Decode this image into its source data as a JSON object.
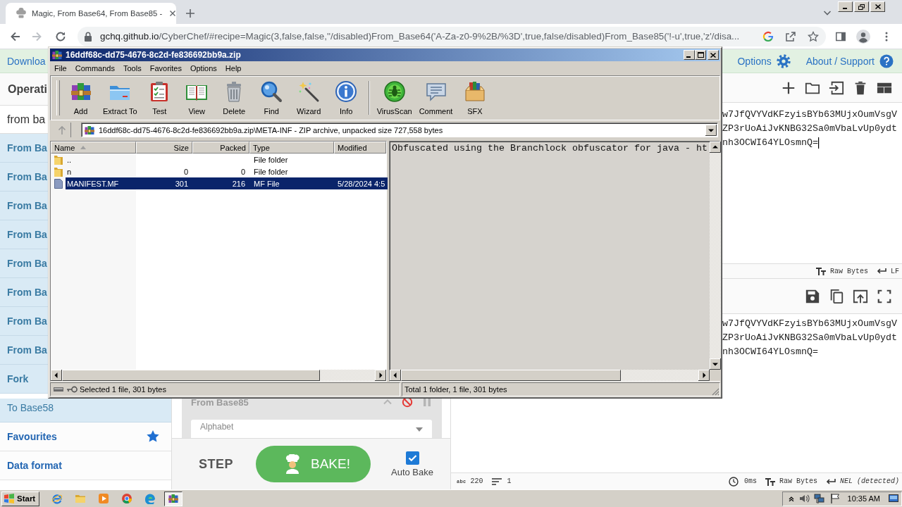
{
  "browser": {
    "tab": {
      "title": "Magic, From Base64, From Base85 -"
    },
    "address": {
      "host": "gchq.github.io",
      "path": "/CyberChef/#recipe=Magic(3,false,false,''/disabled)From_Base64('A-Za-z0-9%2B/%3D',true,false/disabled)From_Base85('!-u',true,'z'/disa..."
    }
  },
  "banner": {
    "download": "Downloa",
    "links": [
      {
        "label": "Options",
        "kind": "options"
      },
      {
        "label": "About / Support",
        "kind": "support"
      }
    ]
  },
  "operations": {
    "heading": "Operati",
    "search": {
      "value": "from ba"
    },
    "items": [
      {
        "label": "From Ba",
        "matched": true
      },
      {
        "label": "From Ba",
        "matched": true
      },
      {
        "label": "From Ba",
        "matched": true
      },
      {
        "label": "From Ba",
        "matched": true
      },
      {
        "label": "From Ba",
        "matched": true
      },
      {
        "label": "From Ba",
        "matched": true
      },
      {
        "label": "From Ba",
        "matched": true
      },
      {
        "label": "From Ba",
        "matched": true
      },
      {
        "label": "Fork",
        "matched": true
      },
      {
        "label": "To Base58",
        "matched": false
      }
    ],
    "categories": [
      {
        "label": "Favourites",
        "kind": "favourites"
      },
      {
        "label": "Data format",
        "kind": "category"
      }
    ]
  },
  "recipe": {
    "operation": {
      "title": "From Base85",
      "disabled": true,
      "field": {
        "label": "Alphabet"
      }
    },
    "step": "STEP",
    "bake": "BAKE!",
    "auto_bake": {
      "label": "Auto Bake",
      "checked": true
    }
  },
  "input": {
    "lines": [
      "w7JfQVYVdKFzyisBYb63MUjxOumVsgV",
      "ZP3rUoAiJvKNBG32Sa0mVbaLvUp0ydt",
      "nh3OCWI64YLOsmnQ="
    ],
    "caret": true,
    "status": {
      "format": "Raw Bytes",
      "eol": "LF"
    }
  },
  "output": {
    "lines": [
      "w7JfQVYVdKFzyisBYb63MUjxOumVsgV",
      "ZP3rUoAiJvKNBG32Sa0mVbaLvUp0ydt",
      "nh3OCWI64YLOsmnQ="
    ],
    "status": {
      "length_label": "abc",
      "length": "220",
      "lines": "1",
      "time": "0ms",
      "format": "Raw Bytes",
      "eol": "NEL (detected)"
    }
  },
  "archiver": {
    "title": "16ddf68c-dd75-4676-8c2d-fe836692bb9a.zip",
    "menu": [
      "File",
      "Commands",
      "Tools",
      "Favorites",
      "Options",
      "Help"
    ],
    "toolbar": [
      {
        "label": "Add",
        "kind": "add"
      },
      {
        "label": "Extract To",
        "kind": "extract"
      },
      {
        "label": "Test",
        "kind": "test"
      },
      {
        "label": "View",
        "kind": "view"
      },
      {
        "label": "Delete",
        "kind": "delete"
      },
      {
        "label": "Find",
        "kind": "find"
      },
      {
        "label": "Wizard",
        "kind": "wizard"
      },
      {
        "label": "Info",
        "kind": "info"
      },
      {
        "label": "VirusScan",
        "kind": "virusscan"
      },
      {
        "label": "Comment",
        "kind": "comment"
      },
      {
        "label": "SFX",
        "kind": "sfx"
      }
    ],
    "path": "16ddf68c-dd75-4676-8c2d-fe836692bb9a.zip\\META-INF - ZIP archive, unpacked size 727,558 bytes",
    "columns": [
      "Name",
      "Size",
      "Packed",
      "Type",
      "Modified"
    ],
    "rows": [
      {
        "kind": "folder",
        "name": "..",
        "type": "File folder",
        "selected": false
      },
      {
        "kind": "folder",
        "name": "n",
        "size": "0",
        "packed": "0",
        "type": "File folder",
        "selected": false
      },
      {
        "kind": "file",
        "name": "MANIFEST.MF",
        "size": "301",
        "packed": "216",
        "type": "MF File",
        "modified": "5/28/2024 4:5",
        "selected": true
      }
    ],
    "preview": "Obfuscated using the Branchlock obfuscator for java - ht",
    "status": {
      "selection": "Selected 1 file, 301 bytes",
      "total": "Total 1 folder, 1 file, 301 bytes"
    }
  },
  "taskbar": {
    "start": "Start",
    "apps": [
      {
        "kind": "ie",
        "selected": false
      },
      {
        "kind": "folder",
        "selected": false
      },
      {
        "kind": "media",
        "selected": false
      },
      {
        "kind": "chrome",
        "selected": false
      },
      {
        "kind": "edge",
        "selected": false
      },
      {
        "kind": "archiver",
        "selected": true
      }
    ],
    "clock": "10:35 AM"
  }
}
